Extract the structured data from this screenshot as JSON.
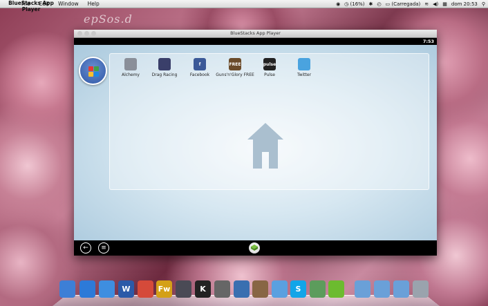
{
  "menubar": {
    "apple_glyph": "",
    "app_name": "BlueStacks App Player",
    "items": [
      "File",
      "Edit",
      "Window",
      "Help"
    ],
    "status": {
      "volume_indicator": "(16%)",
      "battery": "(Carregada)",
      "datetime": "dom 20:53"
    }
  },
  "watermark": "epSos.d",
  "window": {
    "title": "BlueStacks App Player",
    "clock": "7:53",
    "apps": [
      {
        "label": "Alchemy",
        "icon": "alchemy-icon",
        "color": "#8a8f99"
      },
      {
        "label": "Drag Racing",
        "icon": "drag-racing-icon",
        "color": "#3a3f6a"
      },
      {
        "label": "Facebook",
        "icon": "facebook-icon",
        "color": "#3b5998",
        "glyph": "f"
      },
      {
        "label": "Guns'n'Glory FREE",
        "icon": "guns-n-glory-icon",
        "color": "#6b4b2a",
        "glyph": "FREE"
      },
      {
        "label": "Pulse",
        "icon": "pulse-icon",
        "color": "#222",
        "glyph": "pulse"
      },
      {
        "label": "Twitter",
        "icon": "twitter-icon",
        "color": "#4aa3df"
      }
    ]
  },
  "colors": {
    "launcher_tiles": [
      "#e53935",
      "#43a047",
      "#fbc02d",
      "#1e88e5"
    ],
    "home_icon": "#aabfcf"
  },
  "dock": {
    "items": [
      {
        "icon": "finder-icon",
        "color": "#3d7fd6"
      },
      {
        "icon": "itunes-icon",
        "color": "#2d7ad8"
      },
      {
        "icon": "app-store-icon",
        "color": "#3e8ee0"
      },
      {
        "icon": "word-icon",
        "color": "#2c5aa8",
        "glyph": "W"
      },
      {
        "icon": "chrome-icon",
        "color": "#d54a3a"
      },
      {
        "icon": "fireworks-icon",
        "color": "#d4a017",
        "glyph": "Fw"
      },
      {
        "icon": "webcam-icon",
        "color": "#4a4a55"
      },
      {
        "icon": "k-app-icon",
        "color": "#222",
        "glyph": "K"
      },
      {
        "icon": "phone-icon",
        "color": "#666"
      },
      {
        "icon": "xcode-icon",
        "color": "#3a6fb0"
      },
      {
        "icon": "iphoto-icon",
        "color": "#886644"
      },
      {
        "icon": "messages-icon",
        "color": "#5aa0e0"
      },
      {
        "icon": "skype-icon",
        "color": "#12a5e8",
        "glyph": "S"
      },
      {
        "icon": "contacts-icon",
        "color": "#5c9c5c"
      },
      {
        "icon": "bluestacks-icon",
        "color": "#6cbb2f"
      },
      {
        "icon": "applications-folder-icon",
        "color": "#6aa0d8"
      },
      {
        "icon": "documents-folder-icon",
        "color": "#6aa0d8"
      },
      {
        "icon": "downloads-folder-icon",
        "color": "#6aa0d8"
      },
      {
        "icon": "trash-icon",
        "color": "#9aa3ad"
      }
    ]
  }
}
